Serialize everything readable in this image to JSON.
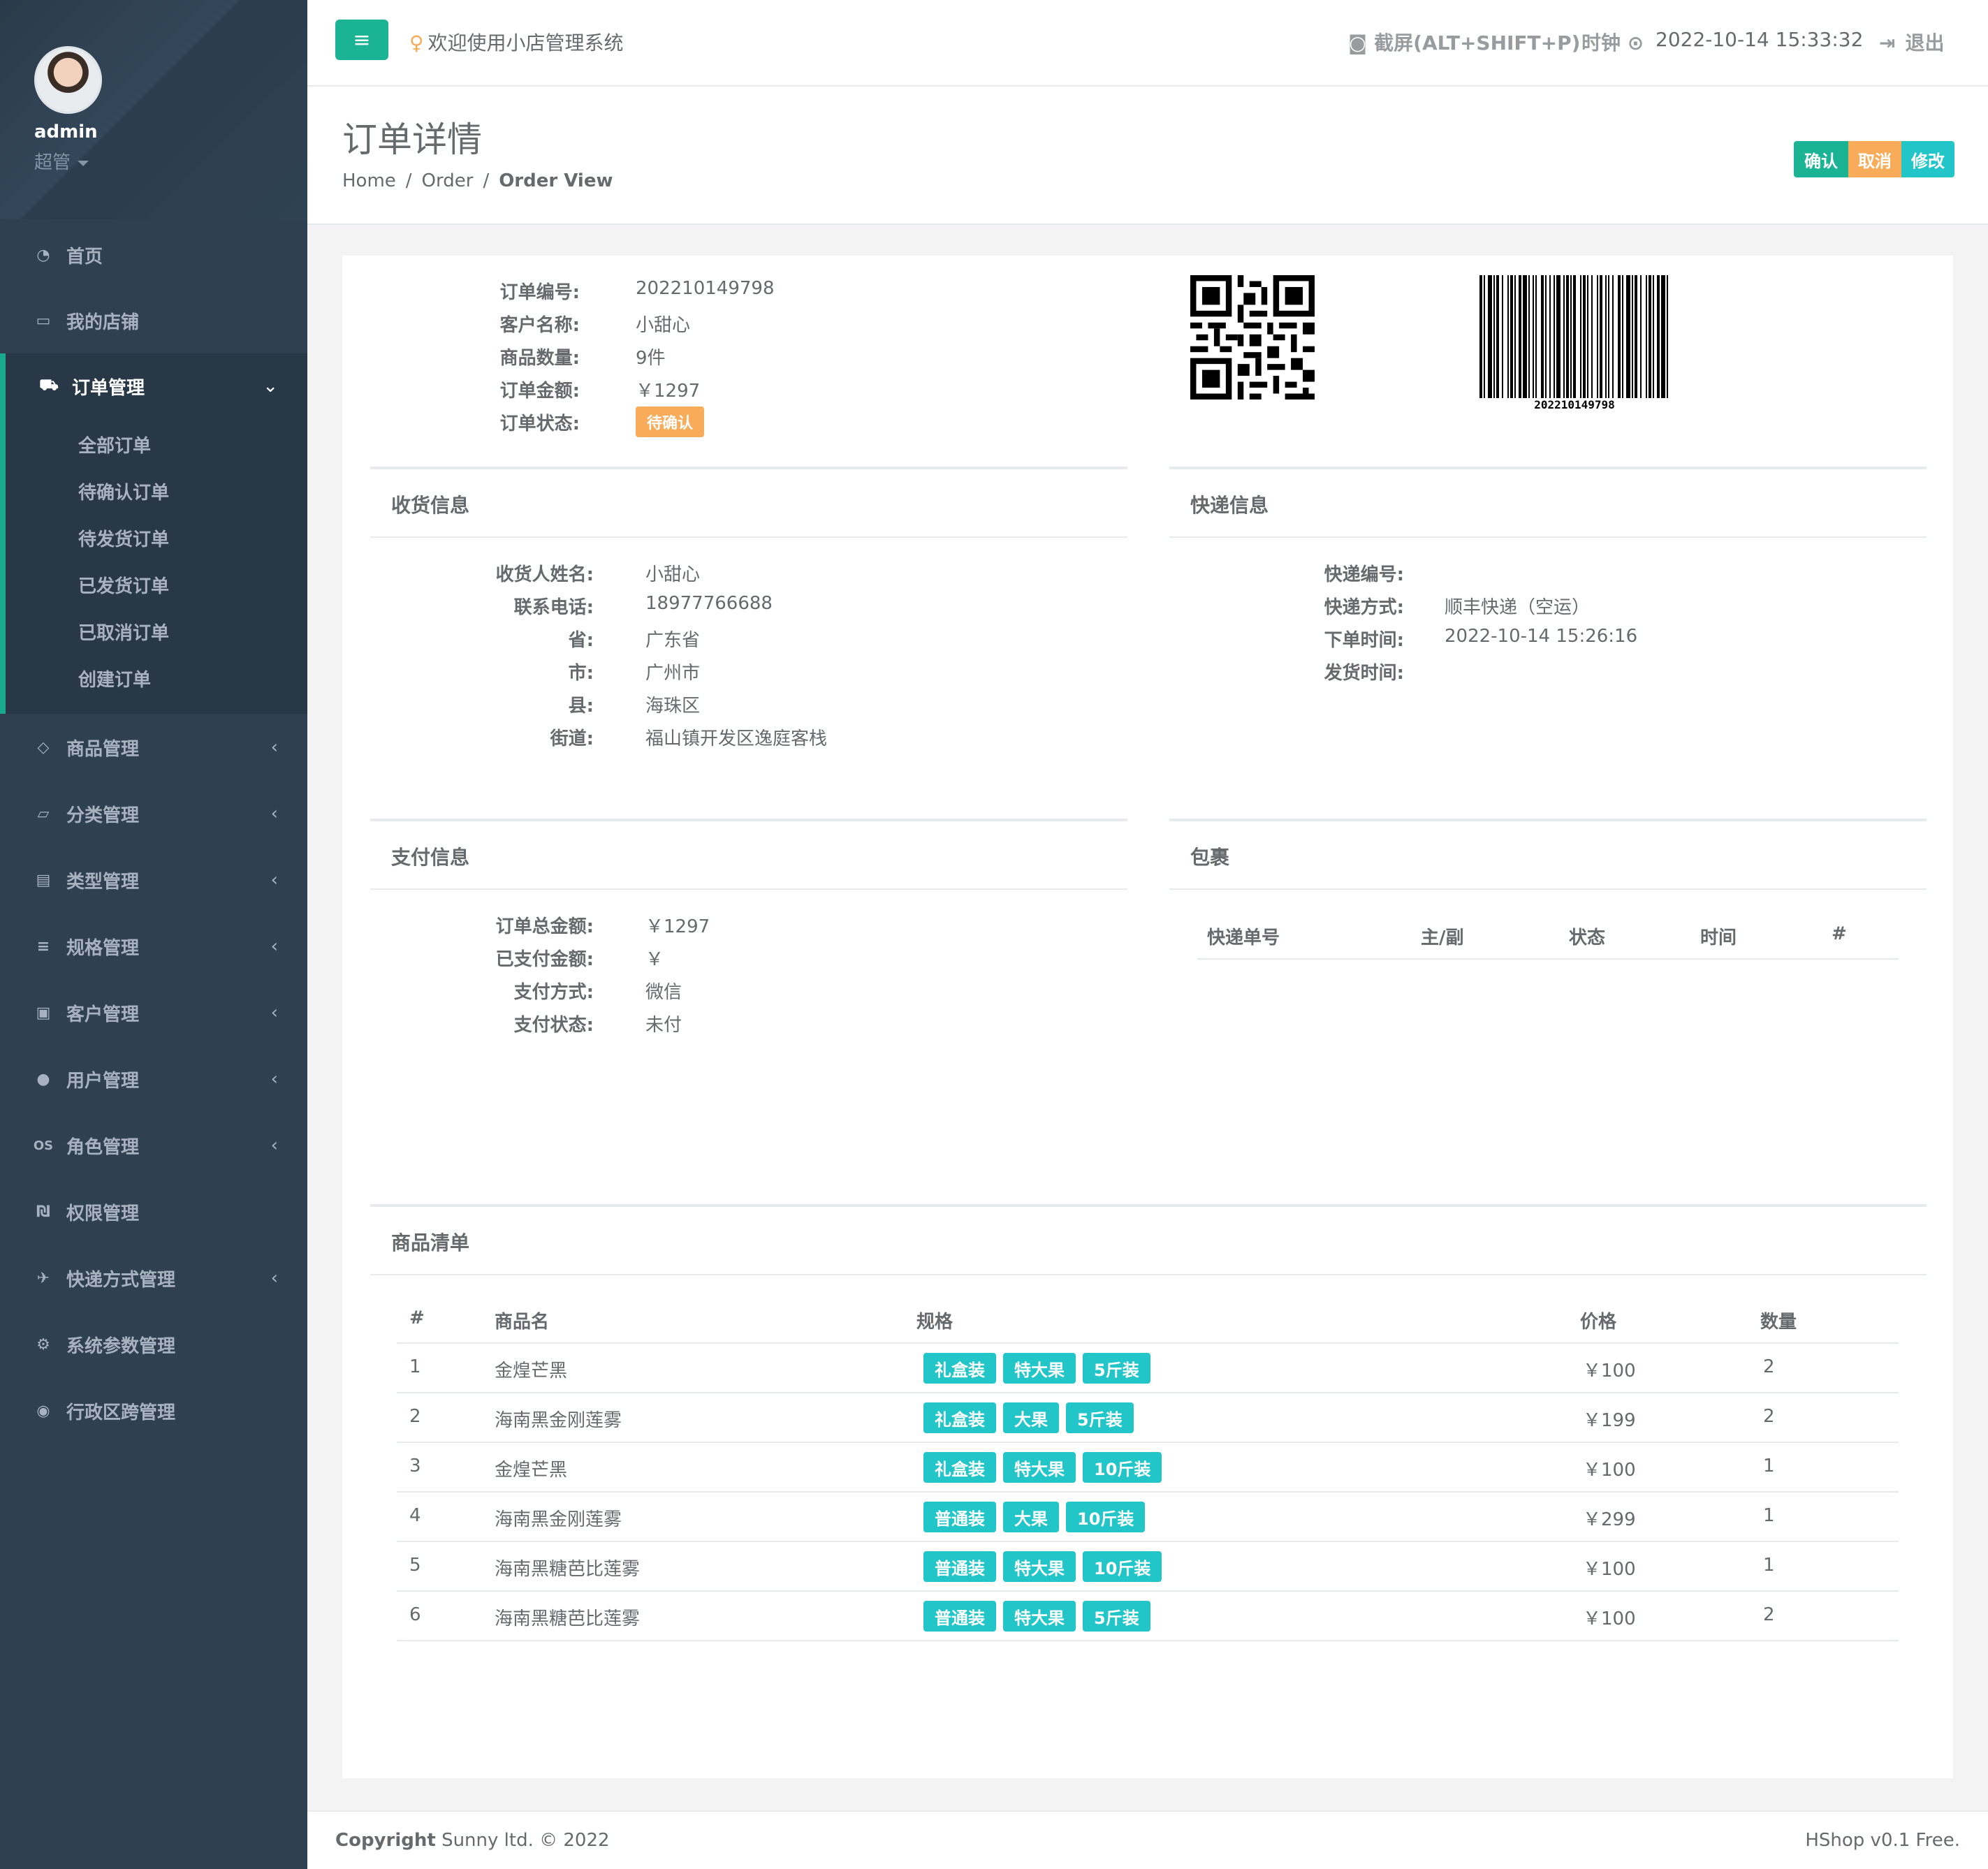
{
  "user": {
    "name": "admin",
    "role": "超管"
  },
  "sidebar": {
    "items": [
      {
        "label": "首页",
        "icon": "dashboard-icon"
      },
      {
        "label": "我的店铺",
        "icon": "laptop-icon"
      },
      {
        "label": "订单管理",
        "icon": "truck-icon",
        "arrow": "⌄"
      },
      {
        "label": "商品管理",
        "icon": "diamond-icon",
        "arrow": "‹"
      },
      {
        "label": "分类管理",
        "icon": "folder-open-icon",
        "arrow": "‹"
      },
      {
        "label": "类型管理",
        "icon": "list-alt-icon",
        "arrow": "‹"
      },
      {
        "label": "规格管理",
        "icon": "align-left-icon",
        "arrow": "‹"
      },
      {
        "label": "客户管理",
        "icon": "id-card-icon",
        "arrow": "‹"
      },
      {
        "label": "用户管理",
        "icon": "user-icon",
        "arrow": "‹"
      },
      {
        "label": "角色管理",
        "icon": "os-icon",
        "arrow": "‹"
      },
      {
        "label": "权限管理",
        "icon": "permission-icon"
      },
      {
        "label": "快递方式管理",
        "icon": "plane-icon",
        "arrow": "‹"
      },
      {
        "label": "系统参数管理",
        "icon": "cogs-icon"
      },
      {
        "label": "行政区跨管理",
        "icon": "map-marker-icon"
      }
    ],
    "order_sub": [
      "全部订单",
      "待确认订单",
      "待发货订单",
      "已发货订单",
      "已取消订单",
      "创建订单"
    ]
  },
  "topbar": {
    "menu_icon": "≡",
    "welcome": "欢迎使用小店管理系统",
    "screenshot": "截屏(ALT+SHIFT+P)",
    "clock_label": "时钟",
    "clock_value": "2022-10-14 15:33:32",
    "logout": "退出"
  },
  "page": {
    "title": "订单详情",
    "breadcrumb": [
      "Home",
      "Order",
      "Order View"
    ],
    "buttons": {
      "confirm": "确认",
      "cancel": "取消",
      "edit": "修改"
    }
  },
  "order": {
    "labels": [
      "订单编号:",
      "客户名称:",
      "商品数量:",
      "订单金额:",
      "订单状态:"
    ],
    "number": "202210149798",
    "customer": "小甜心",
    "quantity": "9件",
    "amount": "￥1297",
    "status": "待确认",
    "barcode_text": "202210149798"
  },
  "shipping": {
    "title": "收货信息",
    "labels": [
      "收货人姓名:",
      "联系电话:",
      "省:",
      "市:",
      "县:",
      "街道:"
    ],
    "values": [
      "小甜心",
      "18977766688",
      "广东省",
      "广州市",
      "海珠区",
      "福山镇开发区逸庭客栈"
    ]
  },
  "express": {
    "title": "快递信息",
    "labels": [
      "快递编号:",
      "快递方式:",
      "下单时间:",
      "发货时间:"
    ],
    "values": [
      "",
      "顺丰快递（空运）",
      "2022-10-14 15:26:16",
      ""
    ]
  },
  "payment": {
    "title": "支付信息",
    "labels": [
      "订单总金额:",
      "已支付金额:",
      "支付方式:",
      "支付状态:"
    ],
    "values": [
      "￥1297",
      "￥",
      "微信",
      "未付"
    ]
  },
  "package": {
    "title": "包裹",
    "headers": [
      "快递单号",
      "主/副",
      "状态",
      "时间",
      "#"
    ]
  },
  "goods": {
    "title": "商品清单",
    "headers": [
      "#",
      "商品名",
      "规格",
      "价格",
      "数量"
    ],
    "rows": [
      {
        "no": "1",
        "name": "金煌芒黑",
        "specs": [
          "礼盒装",
          "特大果",
          "5斤装"
        ],
        "price": "￥100",
        "qty": "2"
      },
      {
        "no": "2",
        "name": "海南黑金刚莲雾",
        "specs": [
          "礼盒装",
          "大果",
          "5斤装"
        ],
        "price": "￥199",
        "qty": "2"
      },
      {
        "no": "3",
        "name": "金煌芒黑",
        "specs": [
          "礼盒装",
          "特大果",
          "10斤装"
        ],
        "price": "￥100",
        "qty": "1"
      },
      {
        "no": "4",
        "name": "海南黑金刚莲雾",
        "specs": [
          "普通装",
          "大果",
          "10斤装"
        ],
        "price": "￥299",
        "qty": "1"
      },
      {
        "no": "5",
        "name": "海南黑糖芭比莲雾",
        "specs": [
          "普通装",
          "特大果",
          "10斤装"
        ],
        "price": "￥100",
        "qty": "1"
      },
      {
        "no": "6",
        "name": "海南黑糖芭比莲雾",
        "specs": [
          "普通装",
          "特大果",
          "5斤装"
        ],
        "price": "￥100",
        "qty": "2"
      }
    ]
  },
  "footer": {
    "copyright_bold": "Copyright",
    "copyright": "Sunny ltd. © 2022",
    "version": "HShop v0.1 Free."
  },
  "colors": {
    "primary": "#1ab394",
    "warning": "#f8ac59",
    "info": "#23c6c8",
    "sidebar": "#2f4050"
  }
}
